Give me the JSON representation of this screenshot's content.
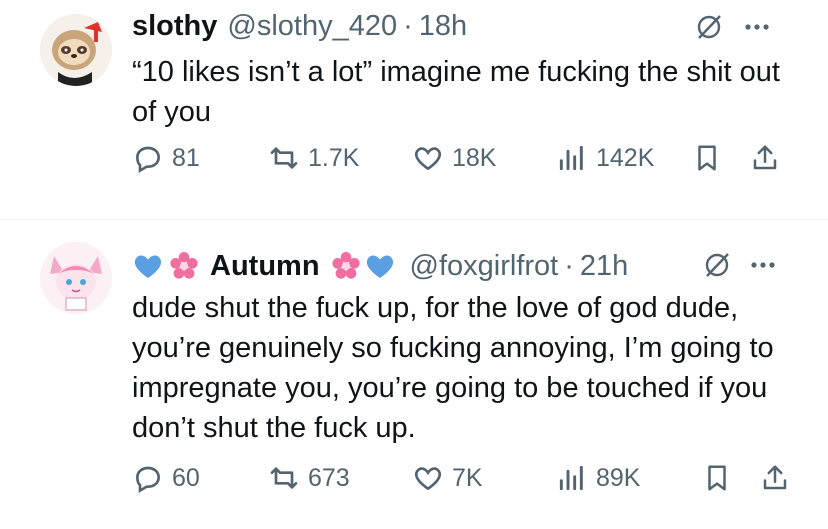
{
  "tweets": [
    {
      "name": "slothy",
      "handle": "@slothy_420",
      "dot": "·",
      "time": "18h",
      "text": "“10 likes isn’t a lot” imagine me fucking the shit out of you",
      "replies": "81",
      "retweets": "1.7K",
      "likes": "18K",
      "views": "142K"
    },
    {
      "name": "Autumn",
      "handle": "@foxgirlfrot",
      "dot": "·",
      "time": "21h",
      "text": "dude shut the fuck up, for the love of god dude, you’re genuinely so fucking annoying, I’m going to impregnate you, you’re going to be touched if you don’t shut the fuck up.",
      "replies": "60",
      "retweets": "673",
      "likes": "7K",
      "views": "89K"
    }
  ],
  "colors": {
    "text": "#0f1419",
    "muted": "#536471",
    "heart_blue": "#5b9fe3",
    "flower_pink": "#f06fa0"
  }
}
